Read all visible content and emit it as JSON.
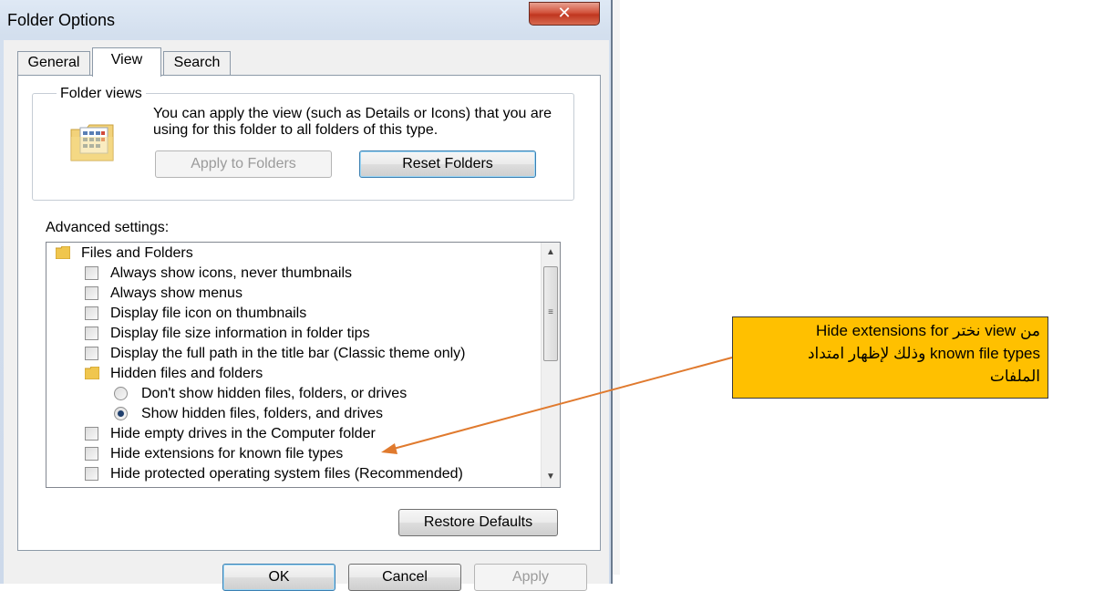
{
  "window": {
    "title": "Folder Options",
    "close_glyph": "✕"
  },
  "tabs": [
    {
      "label": "General"
    },
    {
      "label": "View"
    },
    {
      "label": "Search"
    }
  ],
  "folder_views": {
    "group_label": "Folder views",
    "description": "You can apply the view (such as Details or Icons) that you are using for this folder to all folders of this type.",
    "apply_button": "Apply to Folders",
    "reset_button": "Reset Folders",
    "icon": "folder-views-icon"
  },
  "advanced": {
    "label": "Advanced settings:",
    "items": [
      {
        "type": "folder",
        "label": "Files and Folders",
        "indent": 0
      },
      {
        "type": "checkbox",
        "label": "Always show icons, never thumbnails",
        "checked": false,
        "indent": 1
      },
      {
        "type": "checkbox",
        "label": "Always show menus",
        "checked": false,
        "indent": 1
      },
      {
        "type": "checkbox",
        "label": "Display file icon on thumbnails",
        "checked": false,
        "indent": 1
      },
      {
        "type": "checkbox",
        "label": "Display file size information in folder tips",
        "checked": false,
        "indent": 1
      },
      {
        "type": "checkbox",
        "label": "Display the full path in the title bar (Classic theme only)",
        "checked": false,
        "indent": 1
      },
      {
        "type": "folder",
        "label": "Hidden files and folders",
        "indent": 1
      },
      {
        "type": "radio",
        "label": "Don't show hidden files, folders, or drives",
        "checked": false,
        "indent": 2
      },
      {
        "type": "radio",
        "label": "Show hidden files, folders, and drives",
        "checked": true,
        "indent": 2
      },
      {
        "type": "checkbox",
        "label": "Hide empty drives in the Computer folder",
        "checked": false,
        "indent": 1
      },
      {
        "type": "checkbox",
        "label": "Hide extensions for known file types",
        "checked": false,
        "indent": 1
      },
      {
        "type": "checkbox",
        "label": "Hide protected operating system files (Recommended)",
        "checked": false,
        "indent": 1
      }
    ]
  },
  "restore_defaults": "Restore Defaults",
  "bottom_buttons": [
    {
      "label": "OK"
    },
    {
      "label": "Cancel"
    },
    {
      "label": "Apply"
    }
  ],
  "callout": {
    "lines": [
      "من view نختر  Hide extensions for",
      "known file types وذلك لإظهار امتداد",
      "الملفات"
    ],
    "background": "#ffc000",
    "arrow_color": "#e07a2e"
  },
  "colors": {
    "close_button": "#c8452e",
    "accent": "#3c7fb1"
  }
}
